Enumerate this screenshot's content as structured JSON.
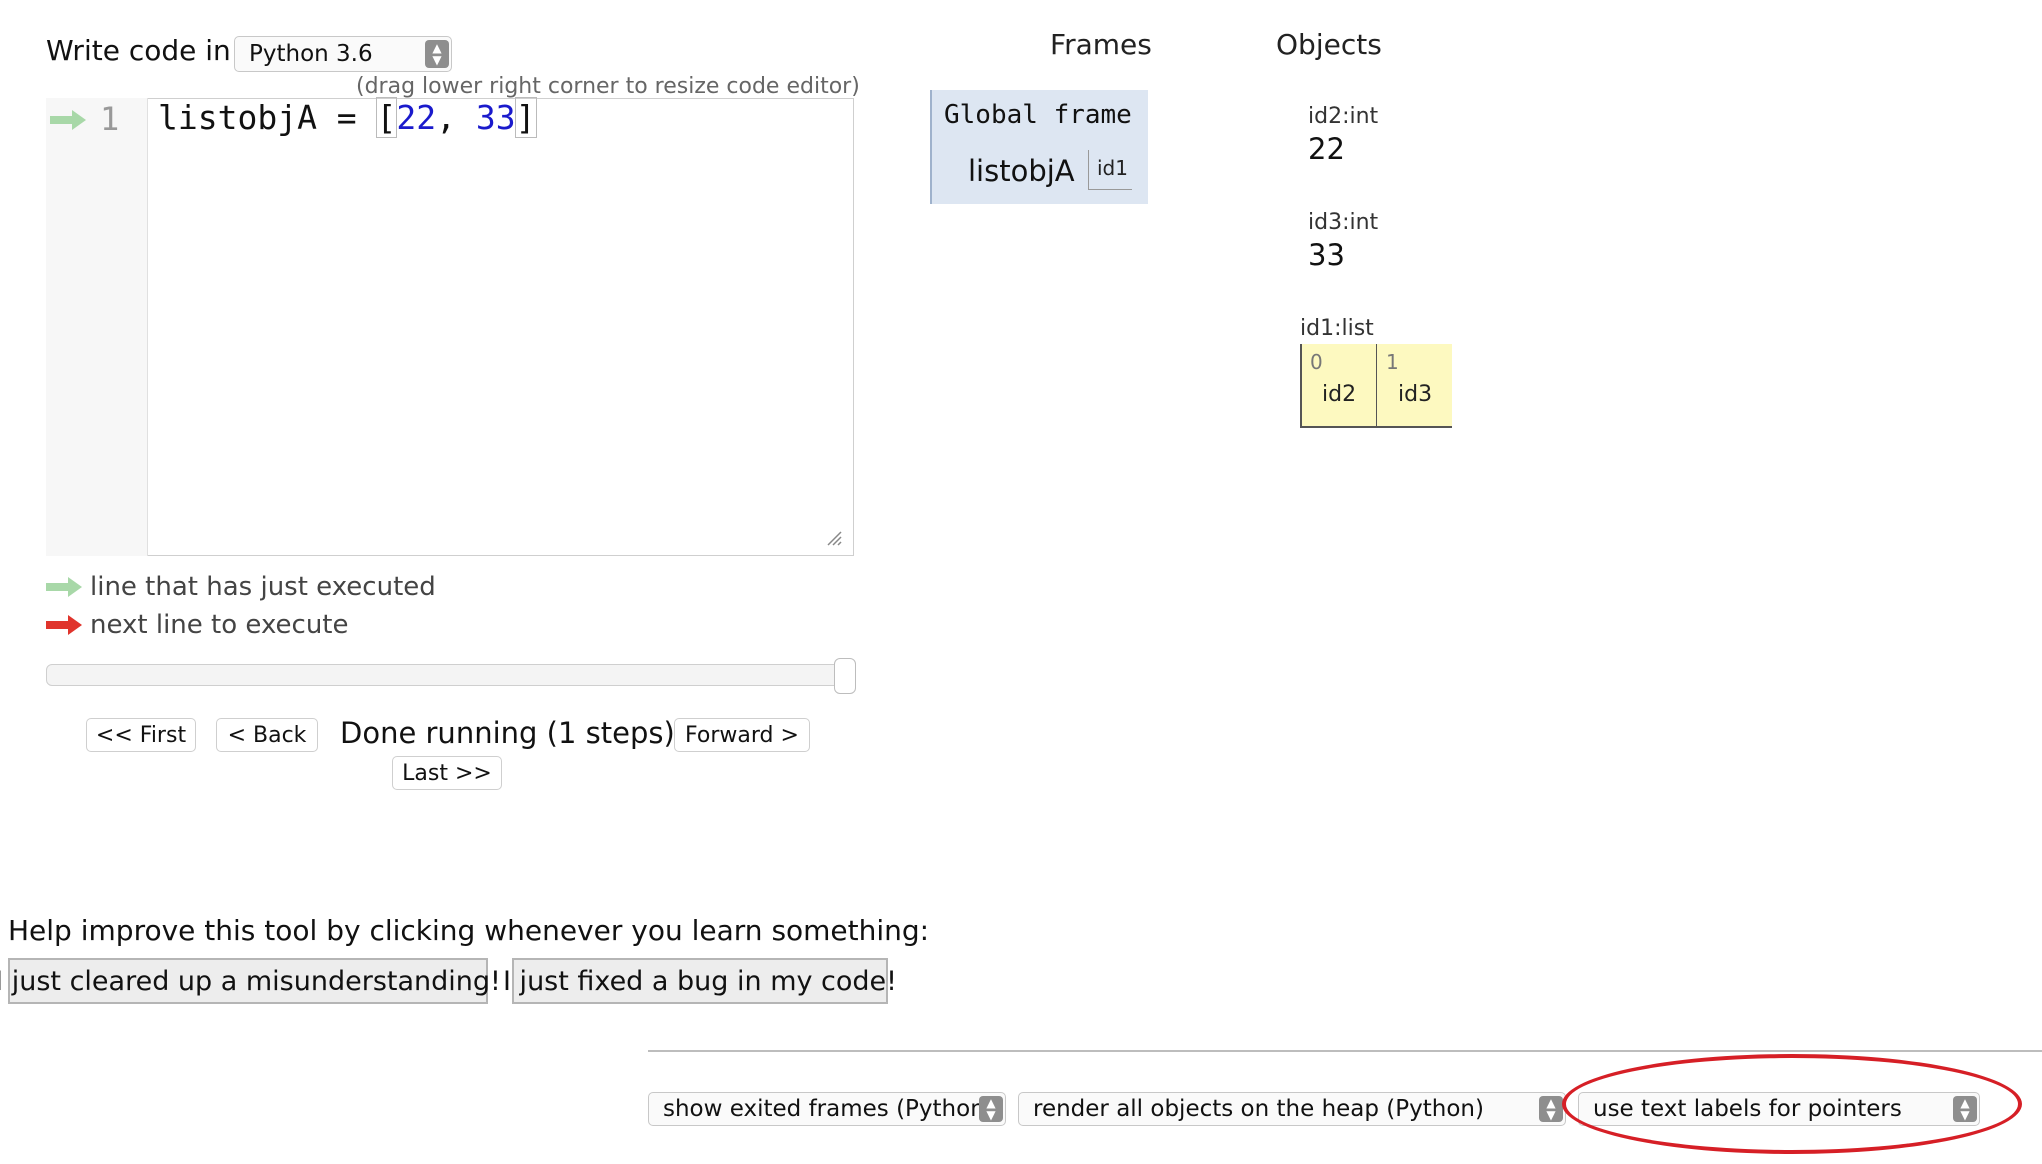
{
  "header": {
    "write_code_label": "Write code in",
    "language_selected": "Python 3.6",
    "editor_hint": "(drag lower right corner to resize code editor)"
  },
  "editor": {
    "line_number": "1",
    "code_prefix": "listobjA = ",
    "code_bracket_open": "[",
    "code_num1": "22",
    "code_sep": ", ",
    "code_num2": "33",
    "code_bracket_close": "]"
  },
  "legend": {
    "executed_label": "line that has just executed",
    "next_label": "next line to execute",
    "executed_color": "#a8d8a8",
    "next_color": "#e0342c"
  },
  "navigation": {
    "first_label": "<< First",
    "back_label": "< Back",
    "status": "Done running (1 steps)",
    "forward_label": "Forward >",
    "last_label": "Last >>",
    "progress": 1.0
  },
  "frames": {
    "header": "Frames",
    "global_frame_title": "Global frame",
    "variable_name": "listobjA",
    "variable_ref": "id1"
  },
  "objects": {
    "header": "Objects",
    "items": [
      {
        "label": "id2:int",
        "value": "22"
      },
      {
        "label": "id3:int",
        "value": "33"
      }
    ],
    "list": {
      "label": "id1:list",
      "cells": [
        {
          "index": "0",
          "value": "id2"
        },
        {
          "index": "1",
          "value": "id3"
        }
      ]
    }
  },
  "help": {
    "prompt": "Help improve this tool by clicking whenever you learn something:",
    "misunderstanding_button": "I just cleared up a misunderstanding!",
    "bug_button": "I just fixed a bug in my code!"
  },
  "options": {
    "exited_frames": "show exited frames (Python)",
    "heap_render": "render all objects on the heap (Python)",
    "pointer_style": "use text labels for pointers",
    "highlight_color": "#d61f26"
  }
}
